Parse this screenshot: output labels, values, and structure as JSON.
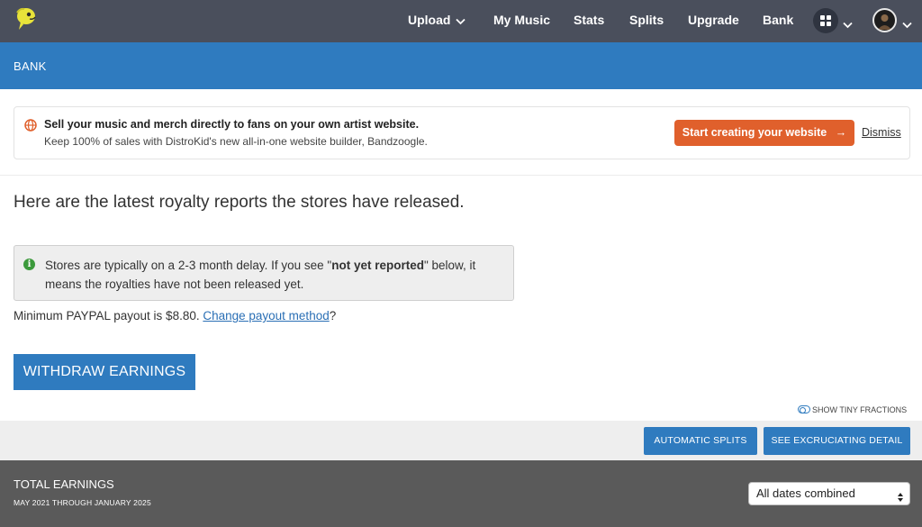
{
  "nav": {
    "items": [
      {
        "label": "Upload"
      },
      {
        "label": "My Music"
      },
      {
        "label": "Stats"
      },
      {
        "label": "Splits"
      },
      {
        "label": "Upgrade"
      },
      {
        "label": "Bank"
      }
    ],
    "icons": [
      "logo-icon",
      "apps-grid-icon",
      "chevron-down-icon",
      "avatar"
    ]
  },
  "band": {
    "title": "BANK"
  },
  "promo": {
    "line1": "Sell your music and merch directly to fans on your own artist website.",
    "line2": "Keep 100% of sales with DistroKid's new all-in-one website builder, Bandzoogle.",
    "cta": "Start creating your website",
    "cta_arrow": "→",
    "dismiss": "Dismiss"
  },
  "main": {
    "headline": "Here are the latest royalty reports the stores have released.",
    "notice_pre": "Stores are typically on a 2-3 month delay. If you see \"",
    "notice_bold": "not yet reported",
    "notice_post": "\" below, it means the royalties have not been released yet.",
    "min_payout_text": "Minimum PAYPAL payout is $8.80. ",
    "change_payout_link": "Change payout method",
    "min_payout_suffix": "?",
    "withdraw_button": "WITHDRAW EARNINGS",
    "tiny_fractions_label": "SHOW TINY FRACTIONS"
  },
  "actions": {
    "automatic_splits": "AUTOMATIC SPLITS",
    "excruciating_detail": "SEE EXCRUCIATING DETAIL"
  },
  "earnings": {
    "title": "TOTAL EARNINGS",
    "range": "MAY 2021 THROUGH JANUARY 2025",
    "date_filter_selected": "All dates combined"
  },
  "colors": {
    "nav_bg": "#4a4f5c",
    "brand_blue": "#2f7bbf",
    "cta_orange": "#e0602c",
    "earnings_bg": "#5a5a5a",
    "logo_yellow": "#e8e33a"
  }
}
